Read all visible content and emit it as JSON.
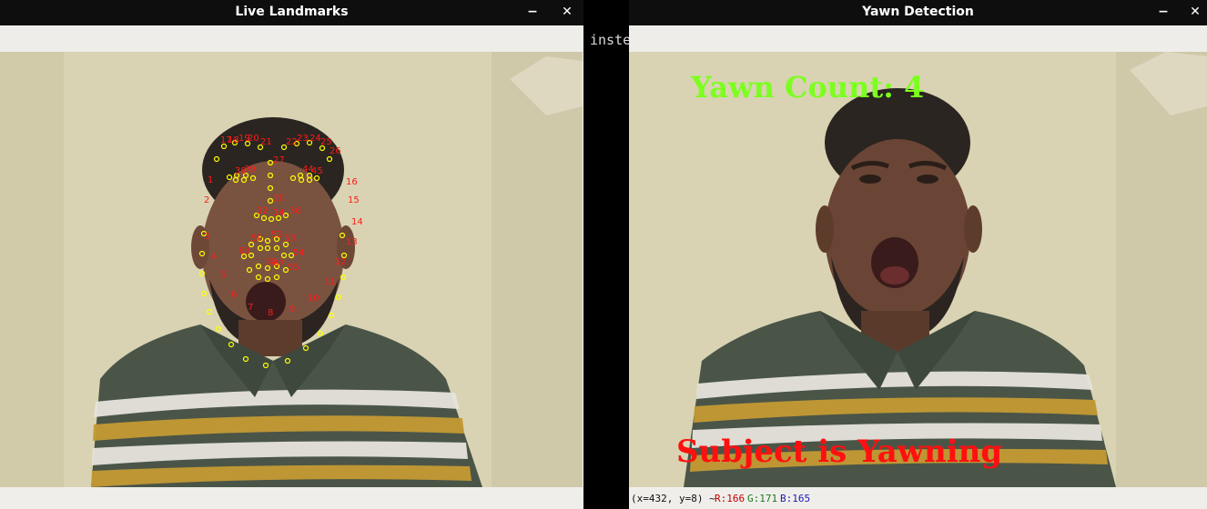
{
  "terminal": {
    "text": "inste"
  },
  "windows": {
    "left": {
      "title": "Live Landmarks",
      "minimize_symbol": "−",
      "close_symbol": "✕",
      "landmark_labels": [
        "1",
        "2",
        "3",
        "4",
        "5",
        "6",
        "7",
        "8",
        "9",
        "10",
        "11",
        "12",
        "13",
        "14",
        "15",
        "16",
        "17",
        "18",
        "19",
        "20",
        "21",
        "22",
        "23",
        "24",
        "25",
        "26",
        "27",
        "28",
        "29",
        "30",
        "31",
        "32",
        "33",
        "34",
        "35",
        "36",
        "37",
        "38",
        "39",
        "40",
        "41",
        "42",
        "43",
        "44",
        "45",
        "46",
        "47",
        "48",
        "49",
        "50",
        "51",
        "52",
        "53",
        "54",
        "55",
        "56",
        "57",
        "58",
        "59",
        "60",
        "61",
        "62",
        "63",
        "64",
        "65",
        "66",
        "67",
        "68"
      ],
      "label_color": "#ff1a1a",
      "marker_color": "#ffff00"
    },
    "right": {
      "title": "Yawn Detection",
      "minimize_symbol": "−",
      "close_symbol": "✕",
      "yawn_count_text": "Yawn Count: 4",
      "yawn_count_color": "#7cff1e",
      "status_text": "Subject is Yawning",
      "status_color": "#ff1010",
      "statusbar": {
        "coords": "(x=432, y=8) ~",
        "r": "R:166",
        "g": "G:171",
        "b": "B:165"
      }
    }
  }
}
